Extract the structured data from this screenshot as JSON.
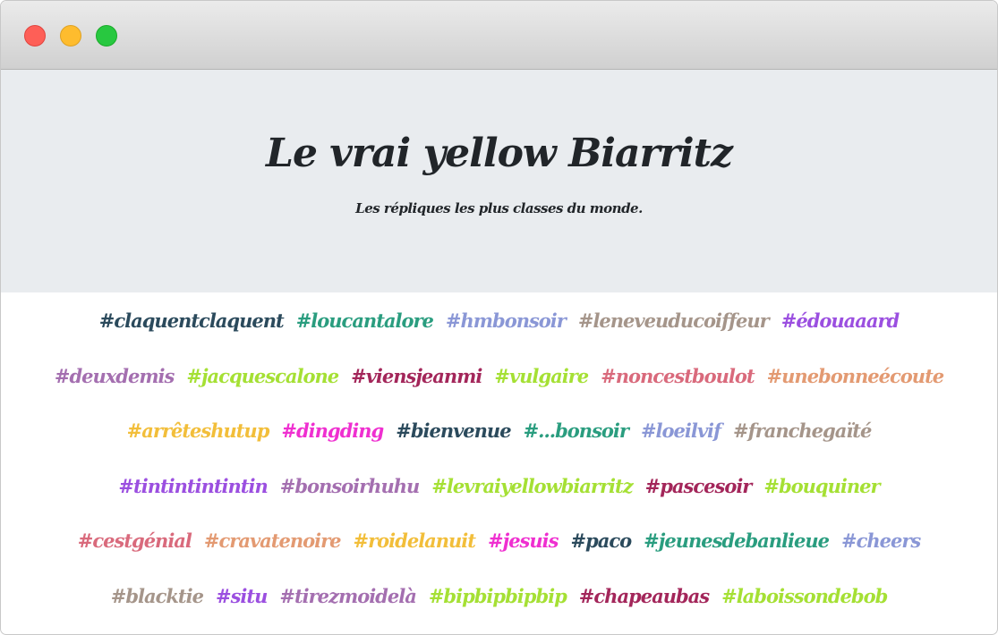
{
  "window": {
    "controls": [
      "close",
      "minimize",
      "maximize"
    ]
  },
  "hero": {
    "title": "Le vrai yellow Biarritz",
    "subtitle": "Les répliques les plus classes du monde."
  },
  "tag_rows": [
    [
      {
        "text": "#claquentclaquent",
        "color": "#2b4a5c"
      },
      {
        "text": "#loucantalore",
        "color": "#2a9d7f"
      },
      {
        "text": "#hmbonsoir",
        "color": "#8a97d6"
      },
      {
        "text": "#leneveuducoiffeur",
        "color": "#a5958a"
      },
      {
        "text": "#édouaaard",
        "color": "#9b4fe0"
      }
    ],
    [
      {
        "text": "#deuxdemis",
        "color": "#a46fb0"
      },
      {
        "text": "#jacquescalone",
        "color": "#a5e034"
      },
      {
        "text": "#viensjeanmi",
        "color": "#a3265a"
      },
      {
        "text": "#vulgaire",
        "color": "#a5e034"
      },
      {
        "text": "#noncestboulot",
        "color": "#d96a7c"
      },
      {
        "text": "#unebonneécoute",
        "color": "#e39a72"
      }
    ],
    [
      {
        "text": "#arrêteshutup",
        "color": "#f2be3a"
      },
      {
        "text": "#dingding",
        "color": "#ef2fd0"
      },
      {
        "text": "#bienvenue",
        "color": "#2b4a5c"
      },
      {
        "text": "#...bonsoir",
        "color": "#2a9d7f"
      },
      {
        "text": "#loeilvif",
        "color": "#8a97d6"
      },
      {
        "text": "#franchegaïté",
        "color": "#a5958a"
      }
    ],
    [
      {
        "text": "#tintintintintin",
        "color": "#9b4fe0"
      },
      {
        "text": "#bonsoirhuhu",
        "color": "#a46fb0"
      },
      {
        "text": "#levraiyellowbiarritz",
        "color": "#a5e034"
      },
      {
        "text": "#pascesoir",
        "color": "#a3265a"
      },
      {
        "text": "#bouquiner",
        "color": "#a5e034"
      }
    ],
    [
      {
        "text": "#cestgénial",
        "color": "#d96a7c"
      },
      {
        "text": "#cravatenoire",
        "color": "#e39a72"
      },
      {
        "text": "#roidelanuit",
        "color": "#f2be3a"
      },
      {
        "text": "#jesuis",
        "color": "#ef2fd0"
      },
      {
        "text": "#paco",
        "color": "#2b4a5c"
      },
      {
        "text": "#jeunesdebanlieue",
        "color": "#2a9d7f"
      },
      {
        "text": "#cheers",
        "color": "#8a97d6"
      }
    ],
    [
      {
        "text": "#blacktie",
        "color": "#a5958a"
      },
      {
        "text": "#situ",
        "color": "#9b4fe0"
      },
      {
        "text": "#tirezmoidelà",
        "color": "#a46fb0"
      },
      {
        "text": "#bipbipbipbip",
        "color": "#a5e034"
      },
      {
        "text": "#chapeaubas",
        "color": "#a3265a"
      },
      {
        "text": "#laboissondebob",
        "color": "#a5e034"
      }
    ]
  ]
}
